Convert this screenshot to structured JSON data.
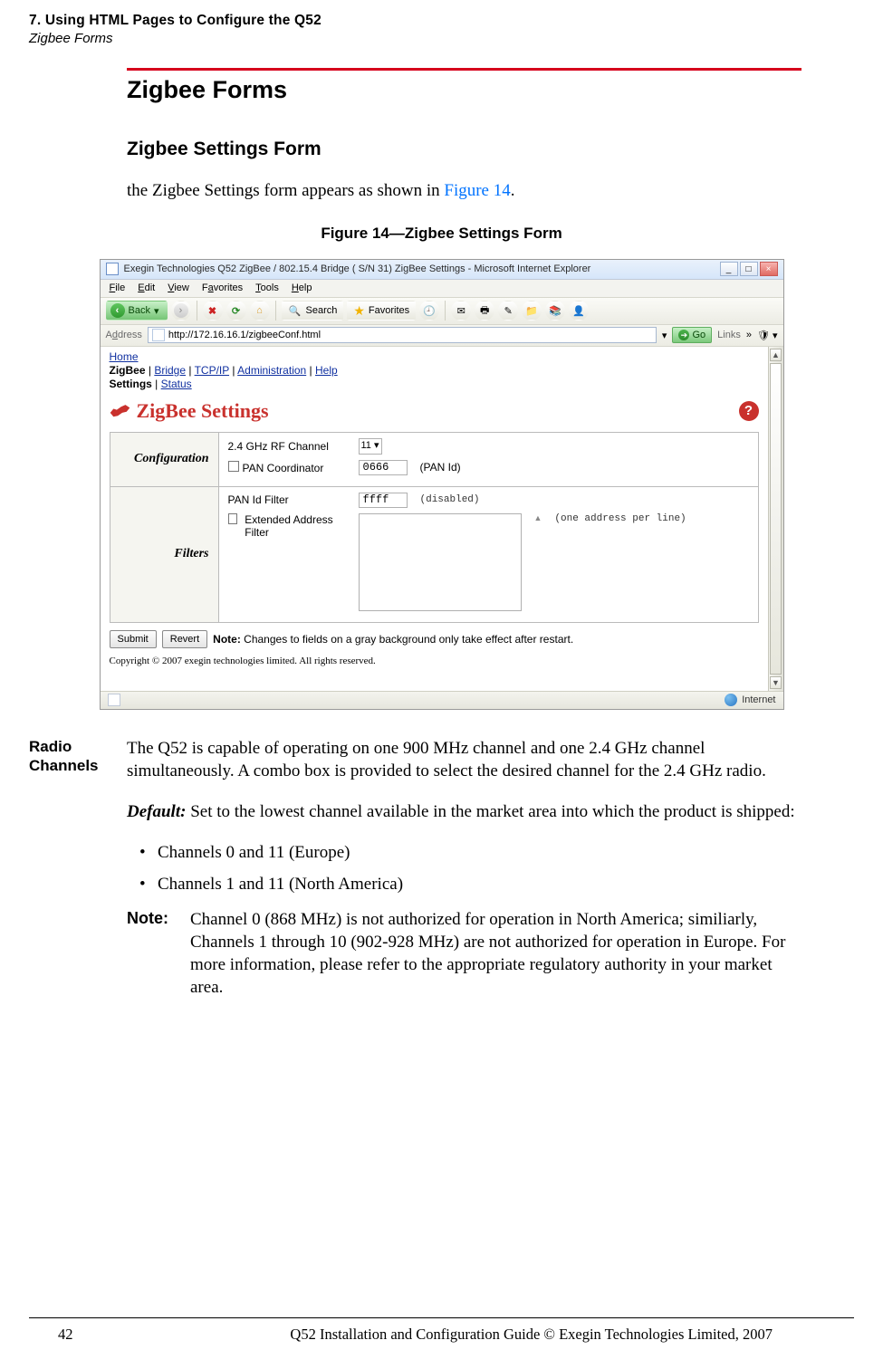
{
  "header": {
    "line1": "7. Using HTML Pages to Configure the Q52",
    "line2": "Zigbee Forms"
  },
  "h1": "Zigbee Forms",
  "h2": "Zigbee Settings Form",
  "intro_prefix": "the Zigbee Settings form appears as shown in ",
  "intro_link": "Figure 14",
  "intro_suffix": ".",
  "fig_caption": "Figure 14—Zigbee Settings Form",
  "ie": {
    "title": "Exegin Technologies Q52 ZigBee / 802.15.4 Bridge ( S/N 31) ZigBee Settings - Microsoft Internet Explorer",
    "menus": {
      "file": "File",
      "edit": "Edit",
      "view": "View",
      "favorites": "Favorites",
      "tools": "Tools",
      "help": "Help"
    },
    "back": "Back",
    "search": "Search",
    "favorites_btn": "Favorites",
    "addr_label": "Address",
    "url": "http://172.16.16.1/zigbeeConf.html",
    "go": "Go",
    "links": "Links",
    "nav": {
      "home": "Home",
      "zigbee": "ZigBee",
      "bridge": "Bridge",
      "tcpip": "TCP/IP",
      "admin": "Administration",
      "help": "Help",
      "settings": "Settings",
      "status": "Status"
    },
    "page_title": "ZigBee Settings",
    "section_config": "Configuration",
    "section_filters": "Filters",
    "label_24": "2.4 GHz RF Channel",
    "sel_24": "11",
    "label_pan_coord": "PAN Coordinator",
    "pan_id_value": "0666",
    "pan_id_label": "(PAN Id)",
    "label_pan_filter": "PAN Id Filter",
    "pan_filter_value": "ffff",
    "pan_filter_disabled": "(disabled)",
    "label_ext_filter": "Extended Address Filter",
    "ext_note": "(one address per line)",
    "submit": "Submit",
    "revert": "Revert",
    "note_label": "Note:",
    "note_text": " Changes to fields on a gray background only take effect after restart.",
    "copyright": "Copyright © 2007 exegin technologies limited. All rights reserved.",
    "status_internet": "Internet"
  },
  "side_label_line1": "Radio",
  "side_label_line2": "Channels",
  "p1": "The Q52 is capable of operating on one 900 MHz channel and one 2.4 GHz channel simultaneously. A combo box is provided to select the desired channel for the 2.4 GHz radio.",
  "p2_prefix": "Default:",
  "p2_rest": " Set to the lowest channel available in the market area into which the product is shipped:",
  "bullet1": "Channels 0 and 11 (Europe)",
  "bullet2": "Channels 1 and 11 (North America)",
  "note_label": "Note:",
  "note_body": "Channel 0 (868 MHz) is not authorized for operation in North America; similiarly, Channels 1 through 10 (902-928 MHz) are not authorized for operation in Europe. For more information, please refer to the appropriate regulatory authority in your market area.",
  "footer": {
    "page": "42",
    "center": "Q52 Installation and Configuration Guide  © Exegin Technologies Limited, 2007"
  }
}
